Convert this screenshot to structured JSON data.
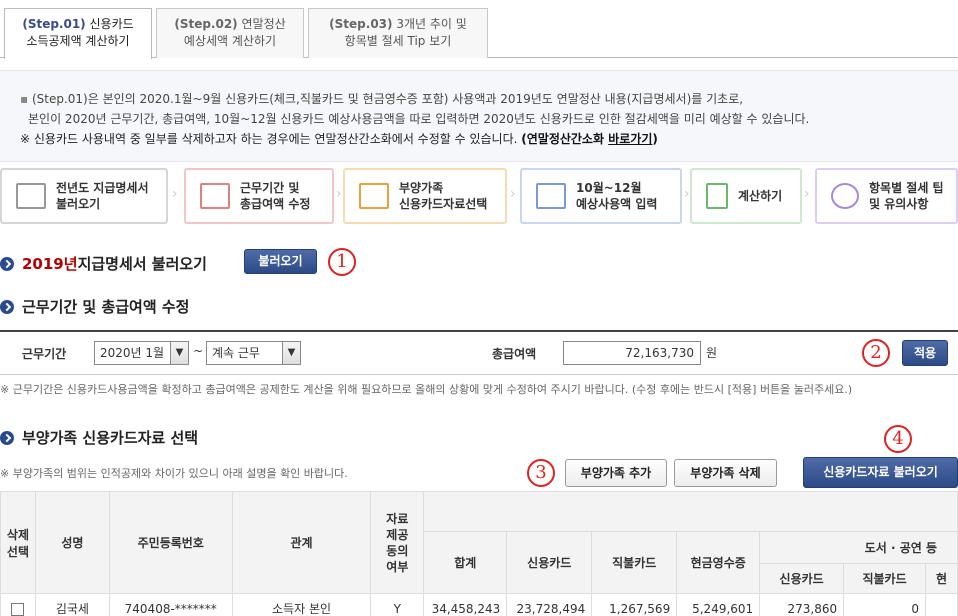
{
  "tabs": [
    {
      "step": "(Step.01)",
      "title1": "신용카드",
      "title2": "소득공제액 계산하기",
      "active": true
    },
    {
      "step": "(Step.02)",
      "title1": "연말정산",
      "title2": "예상세액 계산하기",
      "active": false
    },
    {
      "step": "(Step.03)",
      "title1": "3개년 추이 및",
      "title2": "항목별 절세 Tip 보기",
      "active": false
    }
  ],
  "info": {
    "line1": "(Step.01)은 본인의 2020.1월~9월 신용카드(체크,직불카드 및 현금영수증 포함) 사용액과 2019년도 연말정산 내용(지급명세서)를 기초로,",
    "line2": "본인이 2020년 근무기간, 총급여액, 10월~12월 신용카드 예상사용금액을 따로 입력하면 2020년도 신용카드로 인한 절감세액을 미리 예상할 수 있습니다.",
    "line3_pre": "※ 신용카드 사용내역 중 일부를 삭제하고자 하는 경우에는 연말정산간소화에서 수정할 수 있습니다. ",
    "line3_bold": "(연말정산간소화 ",
    "line3_link": "바로가기",
    "line3_end": ")"
  },
  "flow": [
    {
      "l1": "전년도 지급명세서",
      "l2": "불러오기",
      "icon": "calendar-icon"
    },
    {
      "l1": "근무기간 및",
      "l2": "총급여액 수정",
      "icon": "calendar-grid-icon"
    },
    {
      "l1": "부양가족",
      "l2": "신용카드자료선택",
      "icon": "monitor-icon"
    },
    {
      "l1": "10월~12월",
      "l2": "예상사용액 입력",
      "icon": "card-icon"
    },
    {
      "l1": "계산하기",
      "l2": "",
      "icon": "calculator-icon"
    },
    {
      "l1": "항목별 절세 팁",
      "l2": "및 유의사항",
      "icon": "tip-icon"
    }
  ],
  "section1": {
    "year": "2019년",
    "title": " 지급명세서 불러오기",
    "button": "불러오기",
    "marker": "1"
  },
  "section2": {
    "title": "근무기간 및 총급여액 수정"
  },
  "work": {
    "period_label": "근무기간",
    "start": "2020년 1월",
    "tilde": "~",
    "end": "계속 근무",
    "salary_label": "총급여액",
    "salary": "72,163,730",
    "unit": "원",
    "apply": "적용",
    "marker": "2"
  },
  "note1": "※ 근무기간은 신용카드사용금액을 확정하고 총급여액은 공제한도 계산을 위해 필요하므로 올해의 상황에 맞게 수정하여 주시기 바랍니다. (수정 후에는 반드시 [적용] 버튼을 눌러주세요.)",
  "section3": {
    "title": "부양가족 신용카드자료 선택"
  },
  "note2": "※ 부양가족의 범위는 인적공제와 차이가 있으니 아래 설명을 확인 바랍니다.",
  "buttons": {
    "add": "부양가족 추가",
    "del": "부양가족 삭제",
    "load_card": "신용카드자료 불러오기",
    "marker3": "3",
    "marker4": "4"
  },
  "table": {
    "headers": {
      "delete": "삭제\n선택",
      "name": "성명",
      "rrn": "주민등록번호",
      "relation": "관계",
      "consent": "자료\n제공\n동의\n여부",
      "total": "합계",
      "credit": "신용카드",
      "debit": "직불카드",
      "cash": "현금영수증",
      "books": "도서 · 공연 등",
      "b_credit": "신용카드",
      "b_debit": "직불카드",
      "b_cash": "현"
    },
    "rows": [
      {
        "name": "김국세",
        "rrn": "740408-*******",
        "relation": "소득자 본인",
        "consent": "Y",
        "total": "34,458,243",
        "credit": "23,728,494",
        "debit": "1,267,569",
        "cash": "5,249,601",
        "b_credit": "273,860",
        "b_debit": "0"
      }
    ]
  }
}
